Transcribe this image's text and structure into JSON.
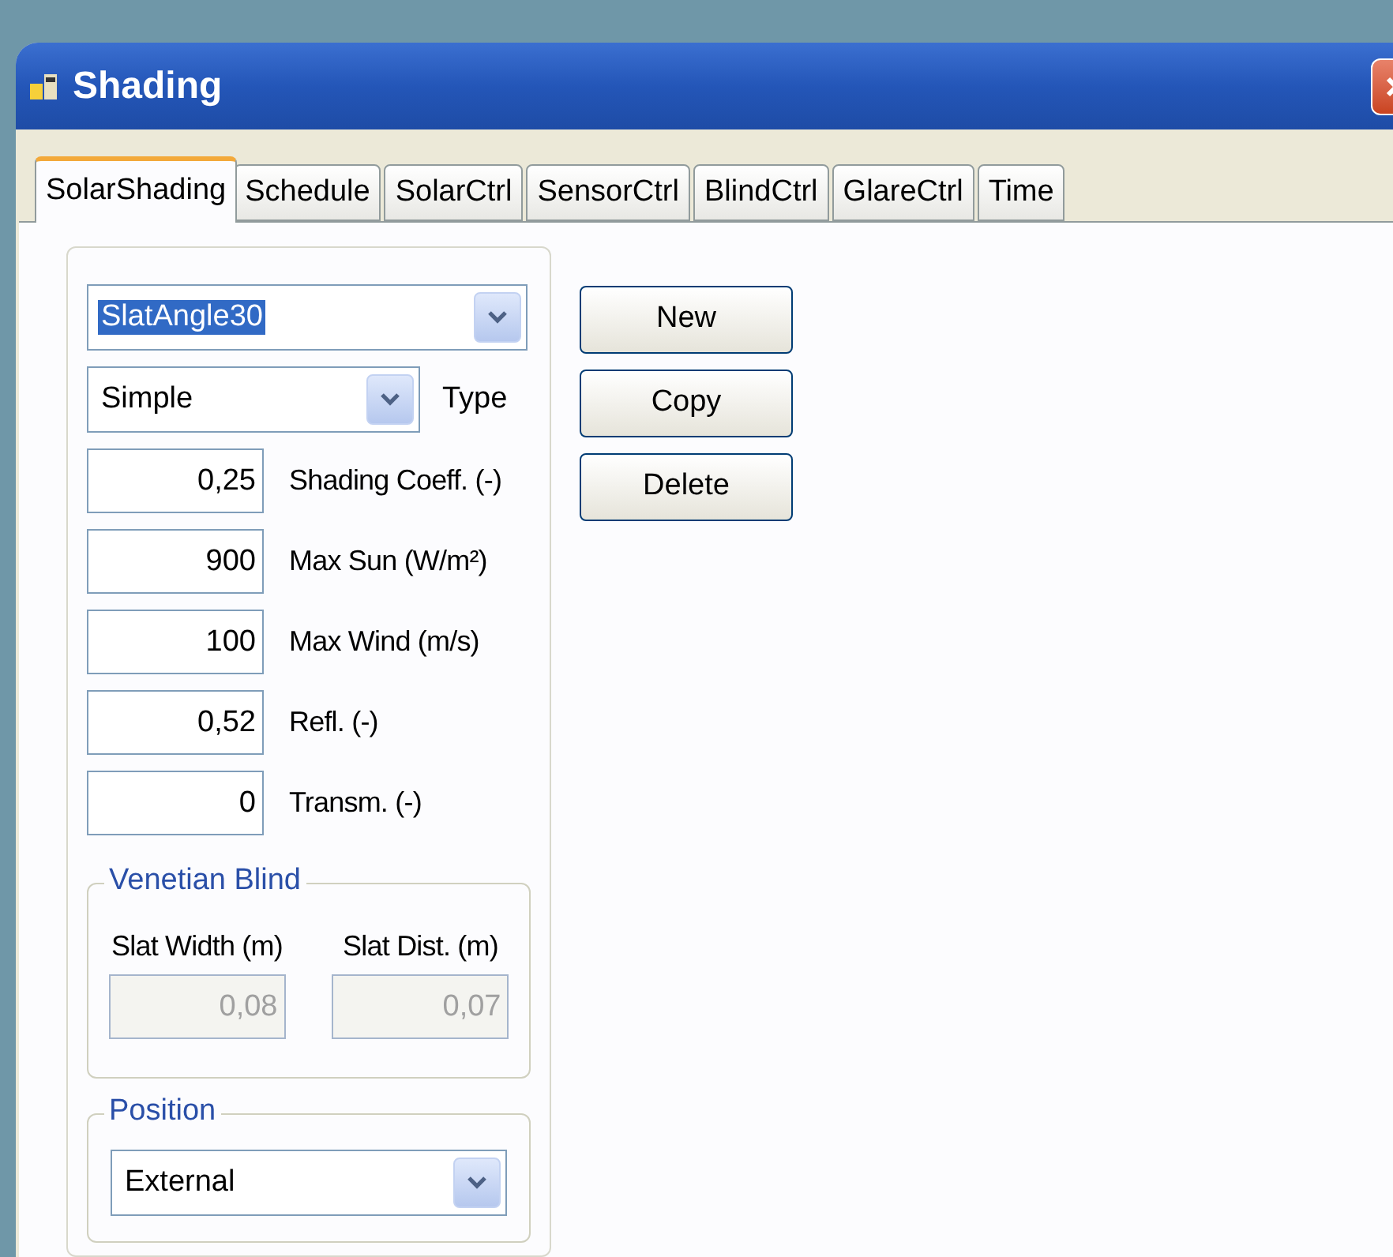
{
  "window": {
    "title": "Shading"
  },
  "tabs": [
    {
      "label": "SolarShading",
      "selected": true
    },
    {
      "label": "Schedule",
      "selected": false
    },
    {
      "label": "SolarCtrl",
      "selected": false
    },
    {
      "label": "SensorCtrl",
      "selected": false
    },
    {
      "label": "BlindCtrl",
      "selected": false
    },
    {
      "label": "GlareCtrl",
      "selected": false
    },
    {
      "label": "Time",
      "selected": false
    }
  ],
  "profile_select": {
    "value": "SlatAngle30",
    "highlighted": true
  },
  "type_select": {
    "value": "Simple",
    "label": "Type"
  },
  "fields": [
    {
      "value": "0,25",
      "label": "Shading Coeff. (-)"
    },
    {
      "value": "900",
      "label": "Max Sun (W/m²)"
    },
    {
      "value": "100",
      "label": "Max Wind (m/s)"
    },
    {
      "value": "0,52",
      "label": "Refl. (-)"
    },
    {
      "value": "0",
      "label": "Transm. (-)"
    }
  ],
  "buttons": [
    "New",
    "Copy",
    "Delete"
  ],
  "venetian_blind": {
    "title": "Venetian Blind",
    "fields": [
      {
        "label": "Slat Width (m)",
        "value": "0,08",
        "disabled": true
      },
      {
        "label": "Slat Dist. (m)",
        "value": "0,07",
        "disabled": true
      }
    ]
  },
  "position": {
    "title": "Position",
    "value": "External"
  }
}
